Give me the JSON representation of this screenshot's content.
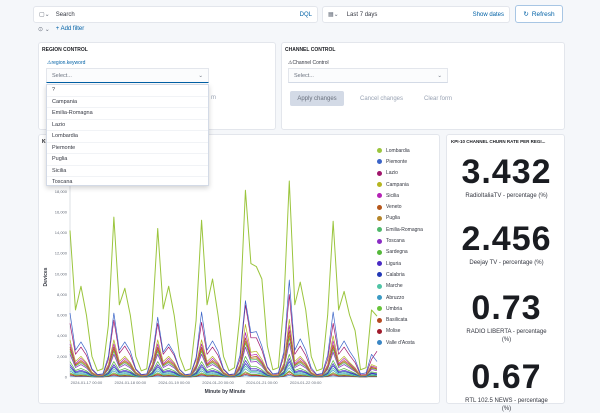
{
  "query_bar": {
    "search_placeholder": "Search",
    "language": "DQL",
    "time_range": "Last 7 days",
    "show_dates": "Show dates",
    "refresh": "Refresh",
    "add_filter": "+ Add filter"
  },
  "region_control": {
    "title": "REGION CONTROL",
    "field_label": "region.keyword",
    "select_placeholder": "Select...",
    "hidden_button_fragment": "m",
    "options": [
      "?",
      "Campania",
      "Emilia-Romagna",
      "Lazio",
      "Lombardia",
      "Piemonte",
      "Puglia",
      "Sicilia",
      "Toscana"
    ]
  },
  "channel_control": {
    "title": "CHANNEL CONTROL",
    "field_label": "Channel Control",
    "select_placeholder": "Select...",
    "apply": "Apply changes",
    "cancel": "Cancel changes",
    "clear": "Clear form"
  },
  "chart_panel": {
    "title_fragment": "KP"
  },
  "kpi_panel": {
    "title": "KPI-10 CHANNEL CHURN RATE PER REGI...",
    "metrics": [
      {
        "value": "3.432",
        "label": "RadioItaliaTV - percentage (%)"
      },
      {
        "value": "2.456",
        "label": "Deejay TV - percentage (%)"
      },
      {
        "value": "0.73",
        "label": "RADIO LIBERTA - percentage (%)"
      },
      {
        "value": "0.67",
        "label": "RTL 102.5 NEWS - percentage (%)"
      }
    ]
  },
  "chart_data": {
    "type": "line",
    "xlabel": "Minute by Minute",
    "ylabel": "Devices",
    "ylim": [
      0,
      19000
    ],
    "grid": false,
    "legend": "right",
    "yticks": [
      "0",
      "2,000",
      "4,000",
      "6,000",
      "8,000",
      "10,000",
      "12,000",
      "14,000",
      "16,000",
      "18,000"
    ],
    "xticks": [
      "2024-01-17 00:00",
      "2024-01-18 00:00",
      "2024-01-19 00:00",
      "2024-01-20 00:00",
      "2024-01-21 00:00",
      "2024-01-22 00:00"
    ],
    "x_start": "2024-01-16 15:00",
    "x_step_hours": 3,
    "series": [
      {
        "name": "Lombardia",
        "color": "#9bc53d",
        "values": [
          14200,
          6500,
          8800,
          6000,
          2000,
          600,
          800,
          5000,
          15500,
          7000,
          8600,
          6000,
          2000,
          600,
          800,
          5500,
          14400,
          6600,
          8800,
          6000,
          2000,
          600,
          800,
          5500,
          15200,
          7000,
          9500,
          6000,
          2000,
          600,
          900,
          6000,
          18100,
          11000,
          10700,
          9500,
          3000,
          700,
          900,
          7000,
          19500,
          7000,
          9200,
          6500,
          2000,
          600,
          800,
          6000,
          15100,
          6500,
          8300,
          6000,
          4500,
          700,
          900,
          6500,
          5900
        ]
      },
      {
        "name": "Piemonte",
        "color": "#3b64c8",
        "values": [
          6200,
          2600,
          3400,
          2500,
          800,
          250,
          300,
          2000,
          6200,
          2600,
          3400,
          2500,
          800,
          250,
          300,
          2000,
          5800,
          2400,
          3200,
          2300,
          750,
          230,
          300,
          1900,
          6300,
          2600,
          3500,
          2500,
          800,
          250,
          300,
          2100,
          7400,
          4300,
          4400,
          3000,
          1000,
          300,
          400,
          2400,
          9400,
          2600,
          3700,
          2600,
          900,
          250,
          350,
          2100,
          6300,
          2600,
          3500,
          2500,
          1700,
          300,
          400,
          2200,
          1500
        ]
      },
      {
        "name": "Lazio",
        "color": "#a0166c",
        "values": [
          5200,
          2200,
          2900,
          2100,
          700,
          200,
          260,
          1700,
          5500,
          2300,
          3000,
          2100,
          700,
          200,
          260,
          1700,
          5200,
          2200,
          2900,
          2100,
          700,
          200,
          260,
          1700,
          5300,
          2200,
          2900,
          2100,
          700,
          200,
          260,
          1700,
          7000,
          3800,
          3800,
          2600,
          900,
          250,
          300,
          2000,
          8000,
          2200,
          3000,
          2100,
          700,
          200,
          260,
          1700,
          5200,
          2200,
          2900,
          2100,
          1400,
          200,
          260,
          1700,
          2500
        ]
      },
      {
        "name": "Campania",
        "color": "#b5b520",
        "values": [
          3600,
          1500,
          2000,
          1400,
          470,
          140,
          180,
          1200,
          3600,
          1500,
          2000,
          1400,
          470,
          140,
          180,
          1200,
          3600,
          1500,
          2000,
          1400,
          470,
          140,
          180,
          1200,
          3600,
          1500,
          2000,
          1400,
          470,
          140,
          180,
          1200,
          5100,
          2400,
          2500,
          1700,
          600,
          160,
          200,
          1300,
          5600,
          1500,
          2000,
          1400,
          470,
          140,
          180,
          1200,
          4000,
          1500,
          2000,
          1400,
          900,
          140,
          180,
          1200,
          1000
        ]
      },
      {
        "name": "Sicilia",
        "color": "#b522b5",
        "values": [
          3200,
          1300,
          1800,
          1300,
          420,
          130,
          160,
          1060,
          3200,
          1300,
          1800,
          1300,
          420,
          130,
          160,
          1060,
          3200,
          1300,
          1800,
          1300,
          420,
          130,
          160,
          1060,
          3200,
          1300,
          1800,
          1300,
          420,
          130,
          160,
          1060,
          4300,
          2100,
          2200,
          1500,
          520,
          150,
          180,
          1150,
          5000,
          1300,
          1800,
          1300,
          420,
          130,
          160,
          1060,
          3500,
          1300,
          1800,
          1300,
          800,
          130,
          160,
          1060,
          900
        ]
      },
      {
        "name": "Veneto",
        "color": "#b5561a",
        "values": [
          2900,
          1200,
          1600,
          1200,
          380,
          120,
          150,
          960,
          2900,
          1200,
          1600,
          1200,
          380,
          120,
          150,
          960,
          2900,
          1200,
          1600,
          1200,
          380,
          120,
          150,
          960,
          2900,
          1200,
          1600,
          1200,
          380,
          120,
          150,
          960,
          3800,
          1900,
          2000,
          1400,
          470,
          140,
          170,
          1050,
          4500,
          1200,
          1600,
          1200,
          380,
          120,
          150,
          960,
          3100,
          1200,
          1600,
          1200,
          700,
          120,
          150,
          960,
          800
        ]
      },
      {
        "name": "Puglia",
        "color": "#b5862a",
        "values": [
          2700,
          1130,
          1490,
          1080,
          350,
          110,
          140,
          890,
          2700,
          1130,
          1490,
          1080,
          350,
          110,
          140,
          890,
          2700,
          1130,
          1490,
          1080,
          350,
          110,
          140,
          890,
          2700,
          1130,
          1490,
          1080,
          350,
          110,
          140,
          890,
          3500,
          1800,
          1850,
          1300,
          440,
          130,
          160,
          980,
          4100,
          1130,
          1490,
          1080,
          350,
          110,
          140,
          890,
          2900,
          1130,
          1490,
          1080,
          650,
          110,
          140,
          890,
          750
        ]
      },
      {
        "name": "Emilia-Romagna",
        "color": "#4fb86a",
        "values": [
          2500,
          1050,
          1380,
          1000,
          330,
          100,
          130,
          830,
          2500,
          1050,
          1380,
          1000,
          330,
          100,
          130,
          830,
          2500,
          1050,
          1380,
          1000,
          330,
          100,
          130,
          830,
          2500,
          1050,
          1380,
          1000,
          330,
          100,
          130,
          830,
          3300,
          1650,
          1700,
          1200,
          400,
          120,
          150,
          900,
          3800,
          1050,
          1380,
          1000,
          330,
          100,
          130,
          830,
          2700,
          1050,
          1380,
          1000,
          600,
          100,
          130,
          830,
          700
        ]
      },
      {
        "name": "Toscana",
        "color": "#8a2bc4",
        "values": [
          2200,
          920,
          1210,
          880,
          290,
          90,
          110,
          730,
          2200,
          920,
          1210,
          880,
          290,
          90,
          110,
          730,
          2200,
          920,
          1210,
          880,
          290,
          90,
          110,
          730,
          2200,
          920,
          1210,
          880,
          290,
          90,
          110,
          730,
          2900,
          1450,
          1500,
          1050,
          350,
          100,
          130,
          800,
          3300,
          920,
          1210,
          880,
          290,
          90,
          110,
          730,
          2400,
          920,
          1210,
          880,
          530,
          90,
          110,
          730,
          600
        ]
      },
      {
        "name": "Sardegna",
        "color": "#54b83a",
        "values": [
          1500,
          630,
          830,
          600,
          200,
          60,
          80,
          500,
          1500,
          630,
          830,
          600,
          200,
          60,
          80,
          500,
          1500,
          630,
          830,
          600,
          200,
          60,
          80,
          500,
          1500,
          630,
          830,
          600,
          200,
          60,
          80,
          500,
          2000,
          1000,
          1000,
          720,
          240,
          70,
          90,
          550,
          2200,
          630,
          830,
          600,
          200,
          60,
          80,
          500,
          1600,
          630,
          830,
          600,
          360,
          60,
          80,
          500,
          400
        ]
      },
      {
        "name": "Liguria",
        "color": "#4a2bc4",
        "values": [
          1200,
          500,
          660,
          480,
          160,
          50,
          60,
          400,
          1200,
          500,
          660,
          480,
          160,
          50,
          60,
          400,
          1200,
          500,
          660,
          480,
          160,
          50,
          60,
          400,
          1200,
          500,
          660,
          480,
          160,
          50,
          60,
          400,
          1600,
          800,
          800,
          580,
          190,
          60,
          70,
          440,
          1800,
          500,
          660,
          480,
          160,
          50,
          60,
          400,
          1300,
          500,
          660,
          480,
          290,
          50,
          60,
          400,
          300
        ]
      },
      {
        "name": "Calabria",
        "color": "#2238b5",
        "values": [
          1000,
          420,
          550,
          400,
          130,
          40,
          50,
          330,
          1000,
          420,
          550,
          400,
          130,
          40,
          50,
          330,
          1000,
          420,
          550,
          400,
          130,
          40,
          50,
          330,
          1000,
          420,
          550,
          400,
          130,
          40,
          50,
          330,
          1300,
          660,
          660,
          480,
          160,
          50,
          60,
          360,
          1500,
          420,
          550,
          400,
          130,
          40,
          50,
          330,
          1100,
          420,
          550,
          400,
          240,
          40,
          50,
          330,
          250
        ]
      },
      {
        "name": "Marche",
        "color": "#4fc4a5",
        "values": [
          800,
          340,
          440,
          320,
          100,
          30,
          40,
          260,
          800,
          340,
          440,
          320,
          100,
          30,
          40,
          260,
          800,
          340,
          440,
          320,
          100,
          30,
          40,
          260,
          800,
          340,
          440,
          320,
          100,
          30,
          40,
          260,
          1050,
          530,
          530,
          380,
          120,
          40,
          50,
          290,
          1200,
          340,
          440,
          320,
          100,
          30,
          40,
          260,
          850,
          340,
          440,
          320,
          190,
          30,
          40,
          260,
          200
        ]
      },
      {
        "name": "Abruzzo",
        "color": "#3a9ac4",
        "values": [
          600,
          250,
          330,
          240,
          80,
          20,
          30,
          200,
          600,
          250,
          330,
          240,
          80,
          20,
          30,
          200,
          600,
          250,
          330,
          240,
          80,
          20,
          30,
          200,
          600,
          250,
          330,
          240,
          80,
          20,
          30,
          200,
          800,
          400,
          400,
          290,
          90,
          30,
          40,
          220,
          900,
          250,
          330,
          240,
          80,
          20,
          30,
          200,
          650,
          250,
          330,
          240,
          140,
          20,
          30,
          200,
          150
        ]
      },
      {
        "name": "Umbria",
        "color": "#68c43a",
        "values": [
          400,
          170,
          220,
          160,
          50,
          20,
          20,
          130,
          400,
          170,
          220,
          160,
          50,
          20,
          20,
          130,
          400,
          170,
          220,
          160,
          50,
          20,
          20,
          130,
          400,
          170,
          220,
          160,
          50,
          20,
          20,
          130,
          520,
          260,
          260,
          190,
          60,
          20,
          30,
          150,
          600,
          170,
          220,
          160,
          50,
          20,
          20,
          130,
          430,
          170,
          220,
          160,
          90,
          20,
          20,
          130,
          100
        ]
      },
      {
        "name": "Basilicata",
        "color": "#b54a22",
        "values": [
          300,
          130,
          170,
          120,
          40,
          10,
          20,
          100,
          300,
          130,
          170,
          120,
          40,
          10,
          20,
          100,
          300,
          130,
          170,
          120,
          40,
          10,
          20,
          100,
          300,
          130,
          170,
          120,
          40,
          10,
          20,
          100,
          400,
          200,
          200,
          140,
          50,
          10,
          20,
          110,
          500,
          130,
          170,
          120,
          40,
          10,
          20,
          100,
          320,
          130,
          170,
          120,
          70,
          10,
          20,
          100,
          80
        ]
      },
      {
        "name": "Molise",
        "color": "#a01a2b",
        "values": [
          200,
          80,
          110,
          80,
          30,
          10,
          10,
          70,
          200,
          80,
          110,
          80,
          30,
          10,
          10,
          70,
          200,
          80,
          110,
          80,
          30,
          10,
          10,
          70,
          200,
          80,
          110,
          80,
          30,
          10,
          10,
          70,
          260,
          130,
          130,
          100,
          30,
          10,
          10,
          80,
          300,
          80,
          110,
          80,
          30,
          10,
          10,
          70,
          210,
          80,
          110,
          80,
          50,
          10,
          10,
          70,
          50
        ]
      },
      {
        "name": "Valle d'Aosta",
        "color": "#3a86c4",
        "values": [
          100,
          40,
          60,
          40,
          10,
          5,
          5,
          30,
          100,
          40,
          60,
          40,
          10,
          5,
          5,
          30,
          100,
          40,
          60,
          40,
          10,
          5,
          5,
          30,
          100,
          40,
          60,
          40,
          10,
          5,
          5,
          30,
          130,
          65,
          65,
          50,
          15,
          5,
          5,
          35,
          150,
          40,
          60,
          40,
          10,
          5,
          5,
          30,
          105,
          40,
          60,
          40,
          25,
          5,
          5,
          30,
          25
        ]
      }
    ]
  }
}
